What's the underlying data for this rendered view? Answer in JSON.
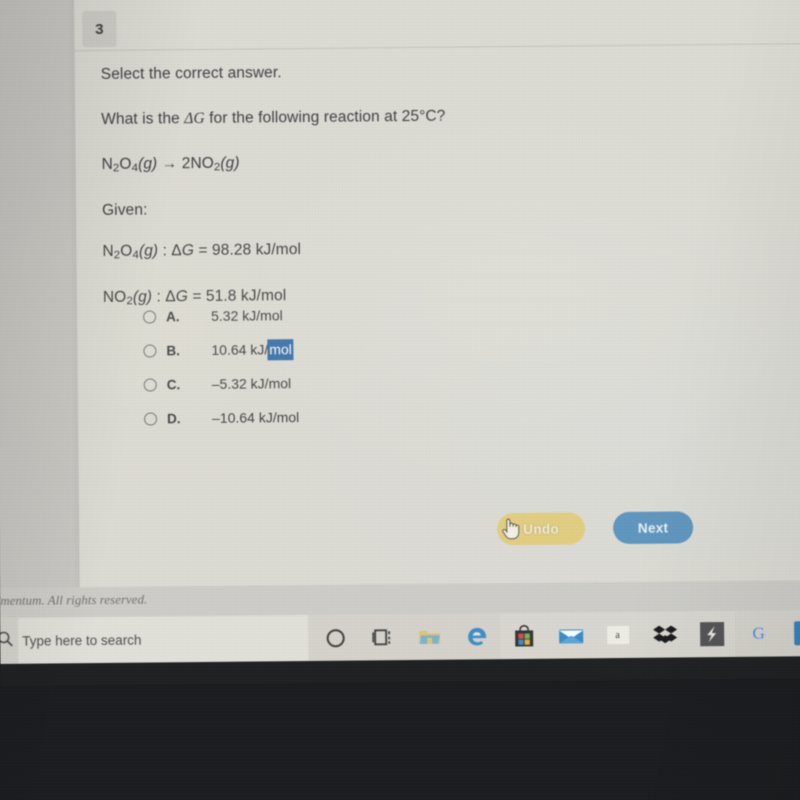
{
  "question": {
    "number": "3",
    "instruction": "Select the correct answer.",
    "prompt_pre": "What is the ",
    "prompt_symbol": "ΔG",
    "prompt_post": " for the following reaction at 25°C?",
    "reaction": "N2O4(g) → 2NO2(g)",
    "given_label": "Given:",
    "given": [
      "N2O4(g) : ΔG = 98.28 kJ/mol",
      "NO2(g) : ΔG = 51.8 kJ/mol"
    ],
    "options": [
      {
        "letter": "A.",
        "text": "5.32 kJ/mol",
        "selected": false
      },
      {
        "letter": "B.",
        "text": "10.64 kJ/",
        "highlight": "mol",
        "selected": false
      },
      {
        "letter": "C.",
        "text": "–5.32 kJ/mol",
        "selected": false
      },
      {
        "letter": "D.",
        "text": "–10.64 kJ/mol",
        "selected": false
      }
    ]
  },
  "buttons": {
    "undo": "Undo",
    "next": "Next",
    "undo_color": "#e9ce6d",
    "next_color": "#4e93c4"
  },
  "footer": {
    "copyright": "dmentum. All rights reserved."
  },
  "taskbar": {
    "search_placeholder": "Type here to search",
    "items": [
      {
        "name": "cortana-icon",
        "label": ""
      },
      {
        "name": "task-view-icon",
        "label": ""
      },
      {
        "name": "file-explorer-icon",
        "label": ""
      },
      {
        "name": "microsoft-edge-icon",
        "label": ""
      },
      {
        "name": "microsoft-store-icon",
        "label": ""
      },
      {
        "name": "mail-icon",
        "label": ""
      },
      {
        "name": "amazon-icon",
        "label": "a"
      },
      {
        "name": "dropbox-icon",
        "label": ""
      },
      {
        "name": "slack-icon",
        "label": ""
      },
      {
        "name": "google-chrome-icon",
        "label": "G"
      },
      {
        "name": "app-icon-blue",
        "label": ""
      }
    ]
  },
  "selection": {
    "highlight_color": "#2f6fb5"
  }
}
